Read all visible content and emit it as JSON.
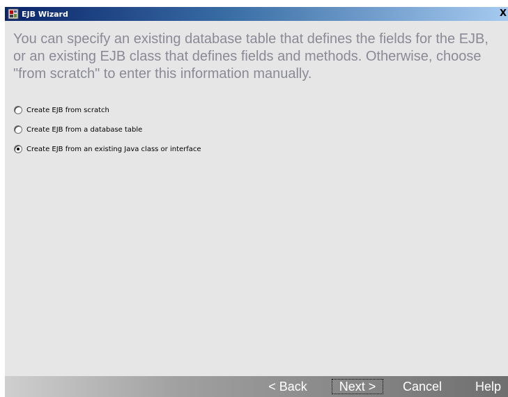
{
  "window": {
    "title": "EJB Wizard",
    "icon": "ejb-wizard-icon",
    "close_label": "X"
  },
  "intro": {
    "text": "You can specify an existing database table that defines the fields for the EJB, or an existing EJB class that defines fields and methods. Otherwise, choose \"from scratch\" to enter this information manually."
  },
  "options": [
    {
      "label": "Create EJB from scratch",
      "selected": false
    },
    {
      "label": "Create EJB from a database table",
      "selected": false
    },
    {
      "label": "Create EJB from an existing Java class or interface",
      "selected": true
    }
  ],
  "footer": {
    "back_label": "< Back",
    "next_label": "Next >",
    "cancel_label": "Cancel",
    "help_label": "Help"
  },
  "colors": {
    "titlebar_start": "#0a246a",
    "titlebar_end": "#a6caf0",
    "intro_text": "#8a8a96",
    "content_bg": "#e7e6e6"
  }
}
